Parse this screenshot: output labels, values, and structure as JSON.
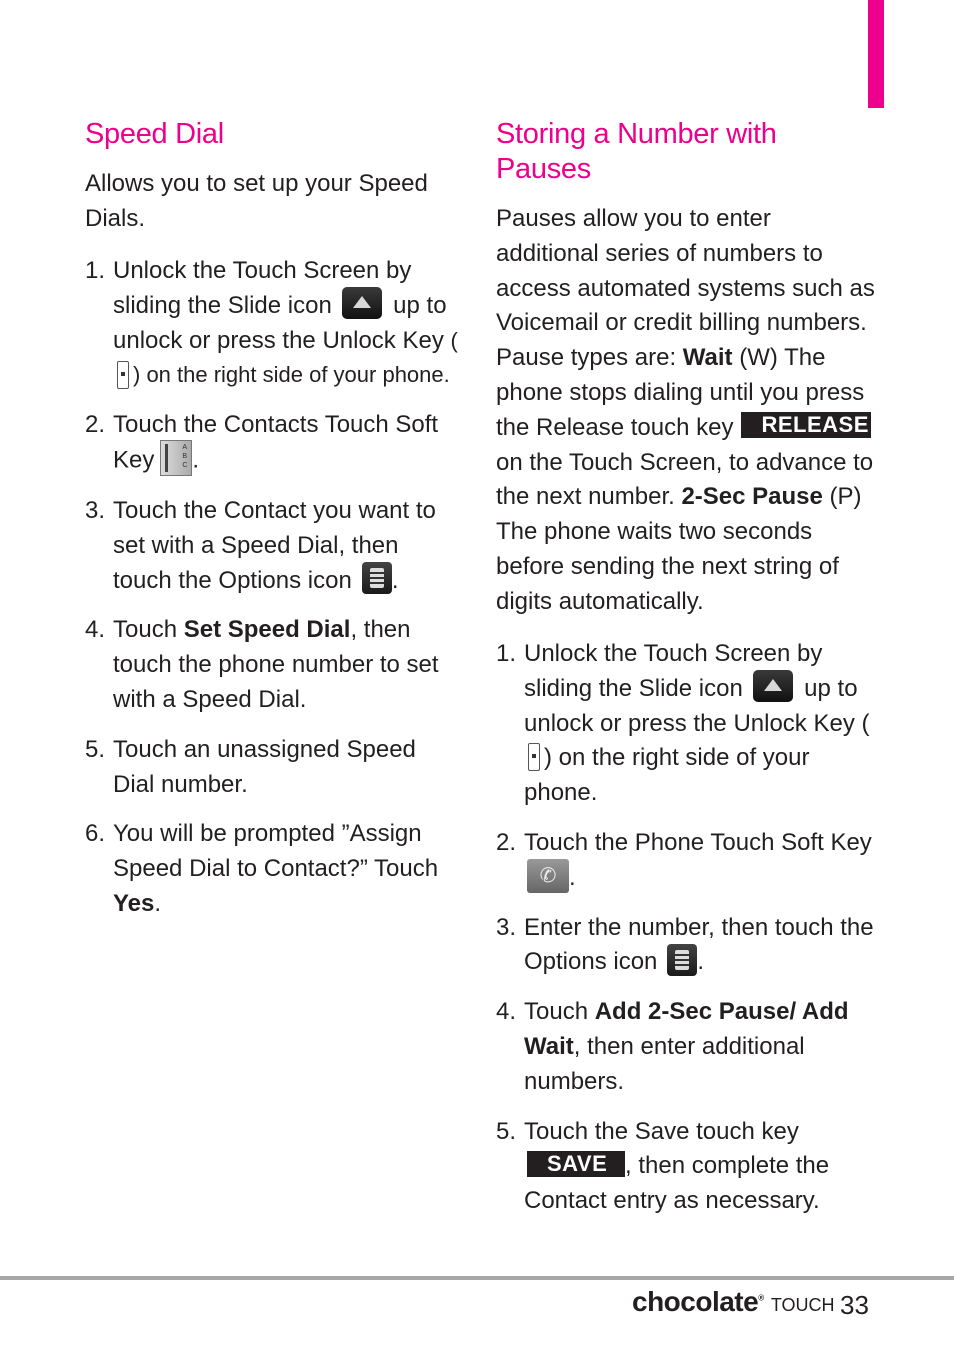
{
  "accent_color": "#ec008c",
  "left": {
    "title": "Speed Dial",
    "intro": "Allows you to set up your Speed Dials.",
    "steps": [
      {
        "num": "1.",
        "a": "Unlock the Touch Screen by sliding the Slide icon",
        "b": "up to unlock or press the Unlock Key",
        "c": "(",
        "d": ") on the right side of your phone."
      },
      {
        "num": "2.",
        "a": "Touch the Contacts Touch Soft Key",
        "b": "."
      },
      {
        "num": "3.",
        "a": "Touch the Contact you want to set with a Speed Dial, then touch the Options icon",
        "b": "."
      },
      {
        "num": "4.",
        "a": "Touch ",
        "bold": "Set Speed Dial",
        "b": ", then touch the phone number to set with a Speed Dial."
      },
      {
        "num": "5.",
        "a": "Touch an unassigned Speed Dial number."
      },
      {
        "num": "6.",
        "a": "You will be prompted ”Assign Speed Dial to Contact?” Touch ",
        "bold": "Yes",
        "b": "."
      }
    ]
  },
  "right": {
    "title": "Storing a Number with Pauses",
    "intro": {
      "p1": "Pauses allow you to enter additional series of numbers to access automated systems such as Voicemail or credit billing numbers. Pause types are: ",
      "wait": "Wait",
      "p2": " (W) The phone stops dialing until you press the Release touch key",
      "release_key": "RELEASE",
      "p3": " on the Touch Screen, to advance to the next number. ",
      "pause": "2-Sec Pause",
      "p4": " (P) The phone waits two seconds before sending the next string of digits automatically."
    },
    "steps": [
      {
        "num": "1.",
        "a": "Unlock the Touch Screen by sliding the Slide icon",
        "b": "up to unlock or press the Unlock Key",
        "c": "(",
        "d": ") on the right side of your phone."
      },
      {
        "num": "2.",
        "a": "Touch the Phone Touch Soft Key",
        "b": "."
      },
      {
        "num": "3.",
        "a": "Enter the number, then touch the Options icon",
        "b": "."
      },
      {
        "num": "4.",
        "a": "Touch ",
        "bold": "Add 2-Sec Pause/ Add Wait",
        "b": ", then enter additional numbers."
      },
      {
        "num": "5.",
        "a": "Touch the Save touch key",
        "save_key": "SAVE",
        "b": ", then complete the Contact entry as necessary."
      }
    ]
  },
  "footer": {
    "brand": "chocolate",
    "brand_sub": "TOUCH",
    "page_number": "33"
  }
}
